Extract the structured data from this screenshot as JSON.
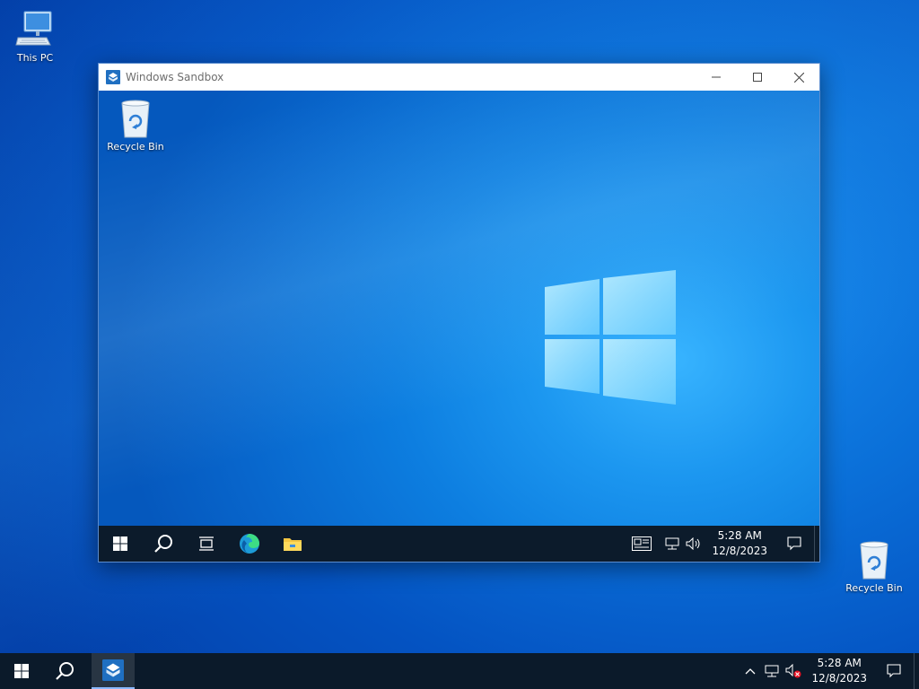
{
  "desktop": {
    "icons": [
      {
        "label": "This PC",
        "icon": "computer-icon"
      },
      {
        "label": "Recycle Bin",
        "icon": "recycle-bin-icon"
      }
    ]
  },
  "sandbox": {
    "title": "Windows Sandbox",
    "app_icon": "sandbox-icon",
    "controls": [
      "minimize-icon",
      "maximize-icon",
      "close-icon"
    ],
    "desktop_icons": [
      {
        "label": "Recycle Bin",
        "icon": "recycle-bin-icon"
      }
    ],
    "taskbar": {
      "buttons": [
        "start-icon",
        "search-icon",
        "task-view-icon",
        "edge-icon",
        "file-explorer-icon"
      ],
      "tray": [
        "news-icon",
        "network-icon",
        "volume-icon"
      ],
      "clock_time": "5:28 AM",
      "clock_date": "12/8/2023",
      "notification_icon": "action-center-icon"
    }
  },
  "host_taskbar": {
    "buttons": [
      "start-icon",
      "search-icon",
      "sandbox-icon"
    ],
    "tray": [
      "chevron-up-icon",
      "network-icon",
      "volume-muted-icon"
    ],
    "clock_time": "5:28 AM",
    "clock_date": "12/8/2023",
    "notification_icon": "action-center-icon"
  },
  "colors": {
    "taskbar": "#0b1a2a",
    "wallpaper_accent": "#1c97f0",
    "window_border": "#5a8ccf"
  }
}
